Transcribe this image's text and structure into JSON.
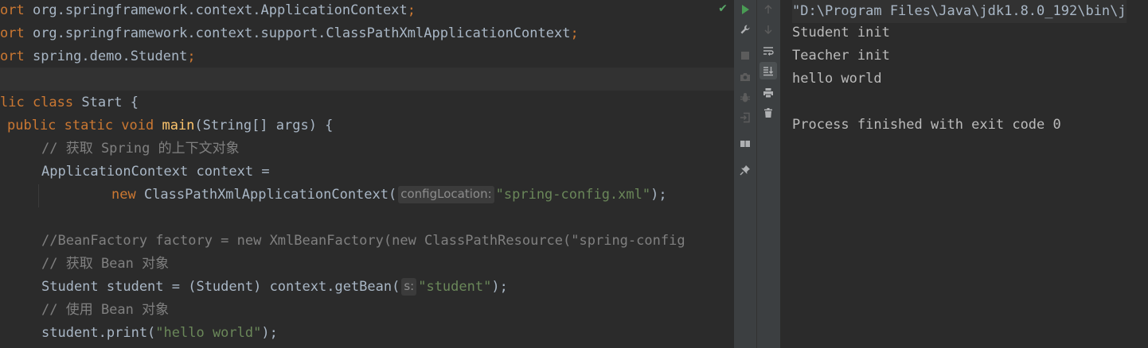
{
  "editor": {
    "lines": [
      {
        "segments": [
          {
            "t": "ort ",
            "c": "kw"
          },
          {
            "t": "org.springframework.context.ApplicationContext",
            "c": ""
          },
          {
            "t": ";",
            "c": "kw"
          }
        ]
      },
      {
        "segments": [
          {
            "t": "ort ",
            "c": "kw"
          },
          {
            "t": "org.springframework.context.support.ClassPathXmlApplicationContext",
            "c": ""
          },
          {
            "t": ";",
            "c": "kw"
          }
        ]
      },
      {
        "segments": [
          {
            "t": "ort ",
            "c": "kw"
          },
          {
            "t": "spring.demo.Student",
            "c": ""
          },
          {
            "t": ";",
            "c": "kw"
          }
        ]
      },
      {
        "segments": []
      },
      {
        "segments": [
          {
            "t": "lic class ",
            "c": "kw"
          },
          {
            "t": "Start {",
            "c": ""
          }
        ]
      },
      {
        "segments": [
          {
            "t": "public static void ",
            "c": "kw"
          },
          {
            "t": "main",
            "c": "fn"
          },
          {
            "t": "(String[] args) {",
            "c": ""
          }
        ]
      },
      {
        "segments": [
          {
            "t": "// 获取 Spring 的上下文对象",
            "c": "cm"
          }
        ]
      },
      {
        "segments": [
          {
            "t": "ApplicationContext context =",
            "c": ""
          }
        ]
      },
      {
        "segments": [
          {
            "t": "new ",
            "c": "kw"
          },
          {
            "t": "ClassPathXmlApplicationContext(",
            "c": ""
          },
          {
            "t": "configLocation:",
            "c": "hint"
          },
          {
            "t": "\"spring-config.xml\"",
            "c": "str"
          },
          {
            "t": ");",
            "c": ""
          }
        ]
      },
      {
        "segments": []
      },
      {
        "segments": [
          {
            "t": "//BeanFactory factory = new XmlBeanFactory(new ClassPathResource(\"spring-config",
            "c": "cm"
          }
        ]
      },
      {
        "segments": [
          {
            "t": "// 获取 Bean 对象",
            "c": "cm"
          }
        ]
      },
      {
        "segments": [
          {
            "t": "Student student = (Student) context.getBean(",
            "c": ""
          },
          {
            "t": "s:",
            "c": "hint"
          },
          {
            "t": "\"student\"",
            "c": "str"
          },
          {
            "t": ");",
            "c": ""
          }
        ]
      },
      {
        "segments": [
          {
            "t": "// 使用 Bean 对象",
            "c": "cm"
          }
        ]
      },
      {
        "segments": [
          {
            "t": "student.print(",
            "c": ""
          },
          {
            "t": "\"hello world\"",
            "c": "str"
          },
          {
            "t": ");",
            "c": ""
          }
        ]
      }
    ]
  },
  "toolbar": {
    "left": [
      {
        "name": "rerun-icon",
        "color": "#499c54",
        "active": false
      },
      {
        "name": "wrench-icon",
        "color": "#afb1b3",
        "active": false
      },
      {
        "name": "stop-icon",
        "color": "#5c5c5c",
        "active": false
      },
      {
        "name": "camera-icon",
        "color": "#5c5c5c",
        "active": false
      },
      {
        "name": "bug-icon",
        "color": "#5c5c5c",
        "active": false
      },
      {
        "name": "exit-icon",
        "color": "#5c5c5c",
        "active": false
      },
      {
        "name": "layout-icon",
        "color": "#afb1b3",
        "active": false
      },
      {
        "name": "pin-icon",
        "color": "#afb1b3",
        "active": false
      }
    ],
    "right": [
      {
        "name": "arrow-up-icon",
        "color": "#5c5c5c",
        "active": false
      },
      {
        "name": "arrow-down-icon",
        "color": "#5c5c5c",
        "active": false
      },
      {
        "name": "soft-wrap-icon",
        "color": "#afb1b3",
        "active": false
      },
      {
        "name": "scroll-to-end-icon",
        "color": "#afb1b3",
        "active": true
      },
      {
        "name": "print-icon",
        "color": "#afb1b3",
        "active": false
      },
      {
        "name": "trash-icon",
        "color": "#afb1b3",
        "active": false
      }
    ]
  },
  "console": {
    "command": "\"D:\\Program Files\\Java\\jdk1.8.0_192\\bin\\j",
    "output": [
      "Student init",
      "Teacher init",
      "hello world",
      "",
      "Process finished with exit code 0"
    ]
  },
  "colors": {
    "keyword": "#cc7832",
    "function": "#ffc66d",
    "string": "#6a8759",
    "comment": "#808080",
    "text": "#a9b7c6",
    "background": "#2b2b2b"
  }
}
